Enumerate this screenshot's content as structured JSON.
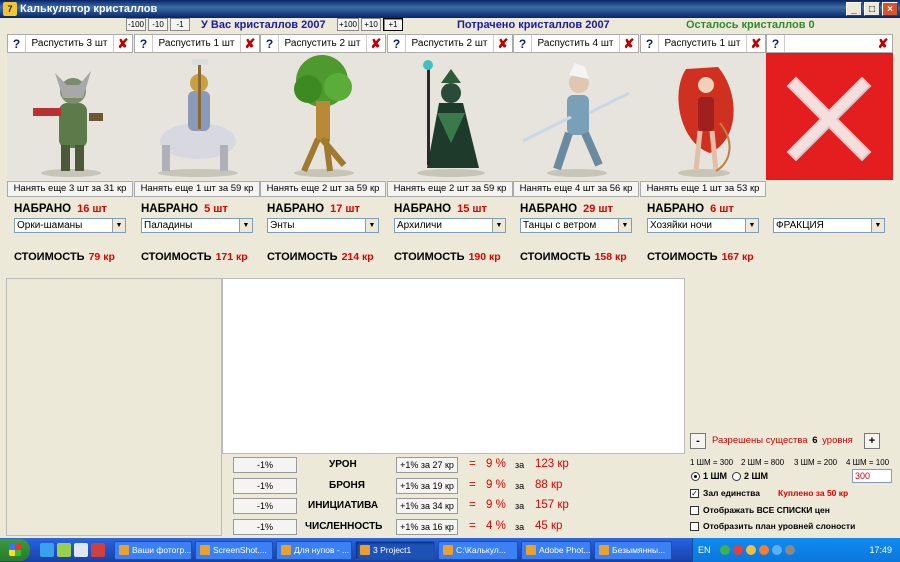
{
  "window": {
    "title": "Калькулятор кристаллов",
    "app_icon": "7"
  },
  "top": {
    "minus_buttons": [
      "-100",
      "-10",
      "-1"
    ],
    "plus_buttons": [
      "+100",
      "+10",
      "+1"
    ],
    "have_text": "У Вас кристаллов 2007",
    "spent_text": "Потрачено кристаллов 2007",
    "left_text": "Осталось кристаллов 0",
    "colors": {
      "have": "#1a1aa8",
      "spent": "#1a1aa8",
      "left": "#2e8b2e"
    }
  },
  "units": [
    {
      "help": "?",
      "dismiss": "Распустить 3 шт",
      "close": "✘",
      "hire": "Нанять еще 3 шт за 31 кр",
      "nabrano_label": "НАБРАНО",
      "count": "16 шт",
      "combo": "Орки-шаманы",
      "cost_label": "СТОИМОСТЬ",
      "cost": "79 кр"
    },
    {
      "help": "?",
      "dismiss": "Распустить 1 шт",
      "close": "✘",
      "hire": "Нанять еще 1 шт за 59 кр",
      "nabrano_label": "НАБРАНО",
      "count": "5 шт",
      "combo": "Паладины",
      "cost_label": "СТОИМОСТЬ",
      "cost": "171 кр"
    },
    {
      "help": "?",
      "dismiss": "Распустить 2 шт",
      "close": "✘",
      "hire": "Нанять еще 2 шт за 59 кр",
      "nabrano_label": "НАБРАНО",
      "count": "17 шт",
      "combo": "Энты",
      "cost_label": "СТОИМОСТЬ",
      "cost": "214 кр"
    },
    {
      "help": "?",
      "dismiss": "Распустить 2 шт",
      "close": "✘",
      "hire": "Нанять еще 2 шт за 59 кр",
      "nabrano_label": "НАБРАНО",
      "count": "15 шт",
      "combo": "Архиличи",
      "cost_label": "СТОИМОСТЬ",
      "cost": "190 кр"
    },
    {
      "help": "?",
      "dismiss": "Распустить 4 шт",
      "close": "✘",
      "hire": "Нанять еще 4 шт за 56 кр",
      "nabrano_label": "НАБРАНО",
      "count": "29 шт",
      "combo": "Танцы с ветром",
      "cost_label": "СТОИМОСТЬ",
      "cost": "158 кр"
    },
    {
      "help": "?",
      "dismiss": "Распустить 1 шт",
      "close": "✘",
      "hire": "Нанять еще 1 шт за 53 кр",
      "nabrano_label": "НАБРАНО",
      "count": "6 шт",
      "combo": "Хозяйки ночи",
      "cost_label": "СТОИМОСТЬ",
      "cost": "167 кр"
    }
  ],
  "seventh": {
    "close": "✘",
    "help": "?",
    "combo": "ФРАКЦИЯ"
  },
  "stats": [
    {
      "minus": "-1%",
      "label": "УРОН",
      "plus": "+1% за 27 кр",
      "eq": "=",
      "percent": "9 %",
      "za": "за",
      "cost": "123 кр"
    },
    {
      "minus": "-1%",
      "label": "БРОНЯ",
      "plus": "+1% за 19 кр",
      "eq": "=",
      "percent": "9 %",
      "za": "за",
      "cost": "88 кр"
    },
    {
      "minus": "-1%",
      "label": "ИНИЦИАТИВА",
      "plus": "+1% за 34 кр",
      "eq": "=",
      "percent": "9 %",
      "za": "за",
      "cost": "157 кр"
    },
    {
      "minus": "-1%",
      "label": "ЧИСЛЕННОСТЬ",
      "plus": "+1% за 16 кр",
      "eq": "=",
      "percent": "4 %",
      "za": "за",
      "cost": "45 кр"
    }
  ],
  "levels": {
    "minus": "-",
    "text_prefix": "Разрешены существа",
    "level": "6",
    "text_suffix": "уровня",
    "plus": "+"
  },
  "shm": {
    "prices": [
      "1 ШМ = 300",
      "2 ШМ = 800",
      "3 ШМ = 200",
      "4 ШМ = 100"
    ],
    "radio1": "1 ШМ",
    "radio2": "2 ШМ",
    "value": "300"
  },
  "options": {
    "unity_hall": "Зал единства",
    "unity_bought": "Куплено за 50 кр",
    "show_all": "Отображать ВСЕ СПИСКИ цен",
    "show_plan": "Отобразить план уровней слоности"
  },
  "taskbar": {
    "tasks": [
      "Ваши фотогр...",
      "ScreenShot....",
      "Для нупов - ...",
      "3 Project1",
      "С:\\Калькул...",
      "Adobe Phot...",
      "Безымянны..."
    ],
    "lang": "EN",
    "clock": "17:49"
  }
}
